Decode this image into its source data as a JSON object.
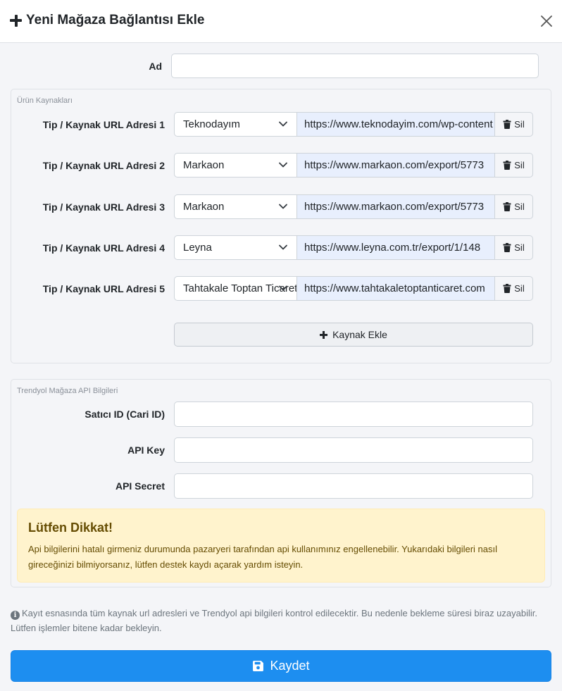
{
  "header": {
    "title": "Yeni Mağaza Bağlantısı Ekle",
    "close_icon": "close-icon"
  },
  "form": {
    "name_label": "Ad",
    "name_value": ""
  },
  "sources": {
    "legend": "Ürün Kaynakları",
    "rows": [
      {
        "label": "Tip / Kaynak URL Adresi 1",
        "type": "Teknodayım",
        "url": "https://www.teknodayim.com/wp-content",
        "delete_label": "Sil"
      },
      {
        "label": "Tip / Kaynak URL Adresi 2",
        "type": "Markaon",
        "url": "https://www.markaon.com/export/5773",
        "delete_label": "Sil"
      },
      {
        "label": "Tip / Kaynak URL Adresi 3",
        "type": "Markaon",
        "url": "https://www.markaon.com/export/5773",
        "delete_label": "Sil"
      },
      {
        "label": "Tip / Kaynak URL Adresi 4",
        "type": "Leyna",
        "url": "https://www.leyna.com.tr/export/1/148",
        "delete_label": "Sil"
      },
      {
        "label": "Tip / Kaynak URL Adresi 5",
        "type": "Tahtakale Toptan Ticaret",
        "url": "https://www.tahtakaletoptanticaret.com",
        "delete_label": "Sil"
      }
    ],
    "add_label": "Kaynak Ekle"
  },
  "api": {
    "legend": "Trendyol Mağaza API Bilgileri",
    "seller_label": "Satıcı ID (Cari ID)",
    "seller_value": "",
    "key_label": "API Key",
    "key_value": "",
    "secret_label": "API Secret",
    "secret_value": ""
  },
  "alert": {
    "title": "Lütfen Dikkat!",
    "text": "Api bilgilerini hatalı girmeniz durumunda pazaryeri tarafından api kullanımınız engellenebilir. Yukarıdaki bilgileri nasıl gireceğinizi bilmiyorsanız, lütfen destek kaydı açarak yardım isteyin."
  },
  "note": "Kayıt esnasında tüm kaynak url adresleri ve Trendyol api bilgileri kontrol edilecektir. Bu nedenle bekleme süresi biraz uzayabilir. Lütfen işlemler bitene kadar bekleyin.",
  "save_label": "Kaydet",
  "colors": {
    "primary": "#1d8ef0",
    "warning_bg": "#fff3cd",
    "warning_text": "#664d03",
    "url_bg": "#e8effd"
  }
}
